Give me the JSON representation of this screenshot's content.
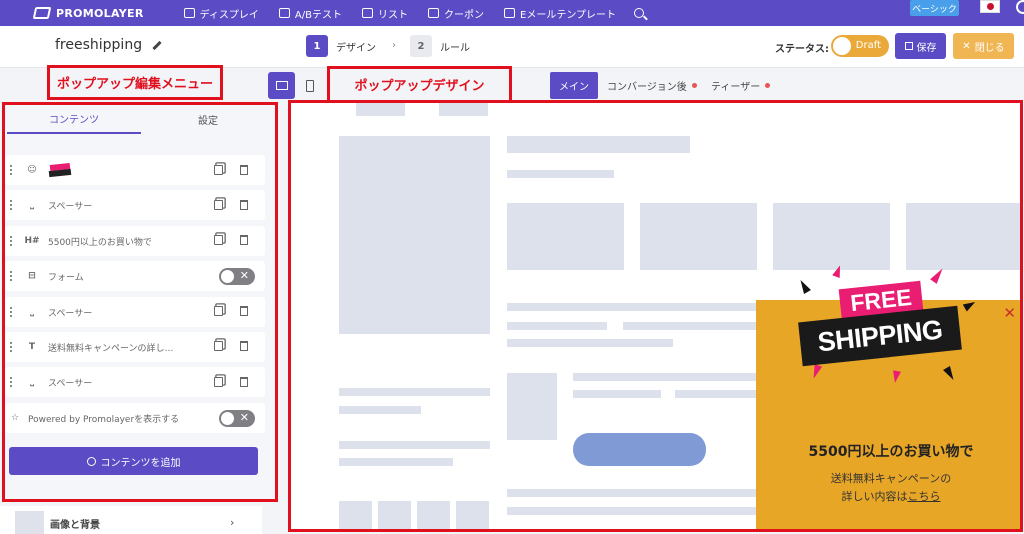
{
  "topnav": {
    "brand": "PROMOLAYER",
    "items": [
      {
        "label": "ディスプレイ",
        "icon": "display-icon"
      },
      {
        "label": "A/Bテスト",
        "icon": "flask-icon"
      },
      {
        "label": "リスト",
        "icon": "list-icon"
      },
      {
        "label": "クーポン",
        "icon": "coupon-icon"
      },
      {
        "label": "Eメールテンプレート",
        "icon": "mail-icon"
      }
    ],
    "plan": "ベーシック"
  },
  "header": {
    "popup_name": "freeshipping",
    "steps": [
      {
        "num": "1",
        "label": "デザイン"
      },
      {
        "num": "2",
        "label": "ルール"
      }
    ],
    "status_label": "ステータス:",
    "status_value": "Draft",
    "save_label": "保存",
    "close_label": "閉じる"
  },
  "annotations": {
    "menu": "ポップアップ編集メニュー",
    "design": "ポップアップデザイン"
  },
  "view_tabs": [
    {
      "label": "メイン"
    },
    {
      "label": "コンバージョン後"
    },
    {
      "label": "ティーザー"
    }
  ],
  "left_panel": {
    "tabs": [
      "コンテンツ",
      "設定"
    ],
    "rows": [
      {
        "icon": "image-icon",
        "label": ""
      },
      {
        "icon": "spacer-icon",
        "label": "スペーサー"
      },
      {
        "icon": "heading-icon",
        "label": "5500円以上のお買い物で"
      },
      {
        "icon": "form-icon",
        "label": "フォーム"
      },
      {
        "icon": "spacer-icon",
        "label": "スペーサー"
      },
      {
        "icon": "text-icon",
        "label": "送料無料キャンペーンの詳し…"
      },
      {
        "icon": "spacer-icon",
        "label": "スペーサー"
      },
      {
        "icon": "star-icon",
        "label": "Powered by Promolayerを表示する"
      }
    ],
    "add_button": "コンテンツを追加",
    "section_bg": "画像と背景"
  },
  "popup": {
    "badge_top": "FREE",
    "badge_bottom": "SHIPPING",
    "title": "5500円以上のお買い物で",
    "desc_line1": "送料無料キャンペーンの",
    "desc_line2_prefix": "詳しい内容は",
    "desc_link": "こちら",
    "colors": {
      "background": "#e8a627",
      "accent": "#e91e73"
    }
  },
  "colors": {
    "primary": "#5b4bc4",
    "annotation": "#e0101e",
    "warning": "#f0b654"
  }
}
